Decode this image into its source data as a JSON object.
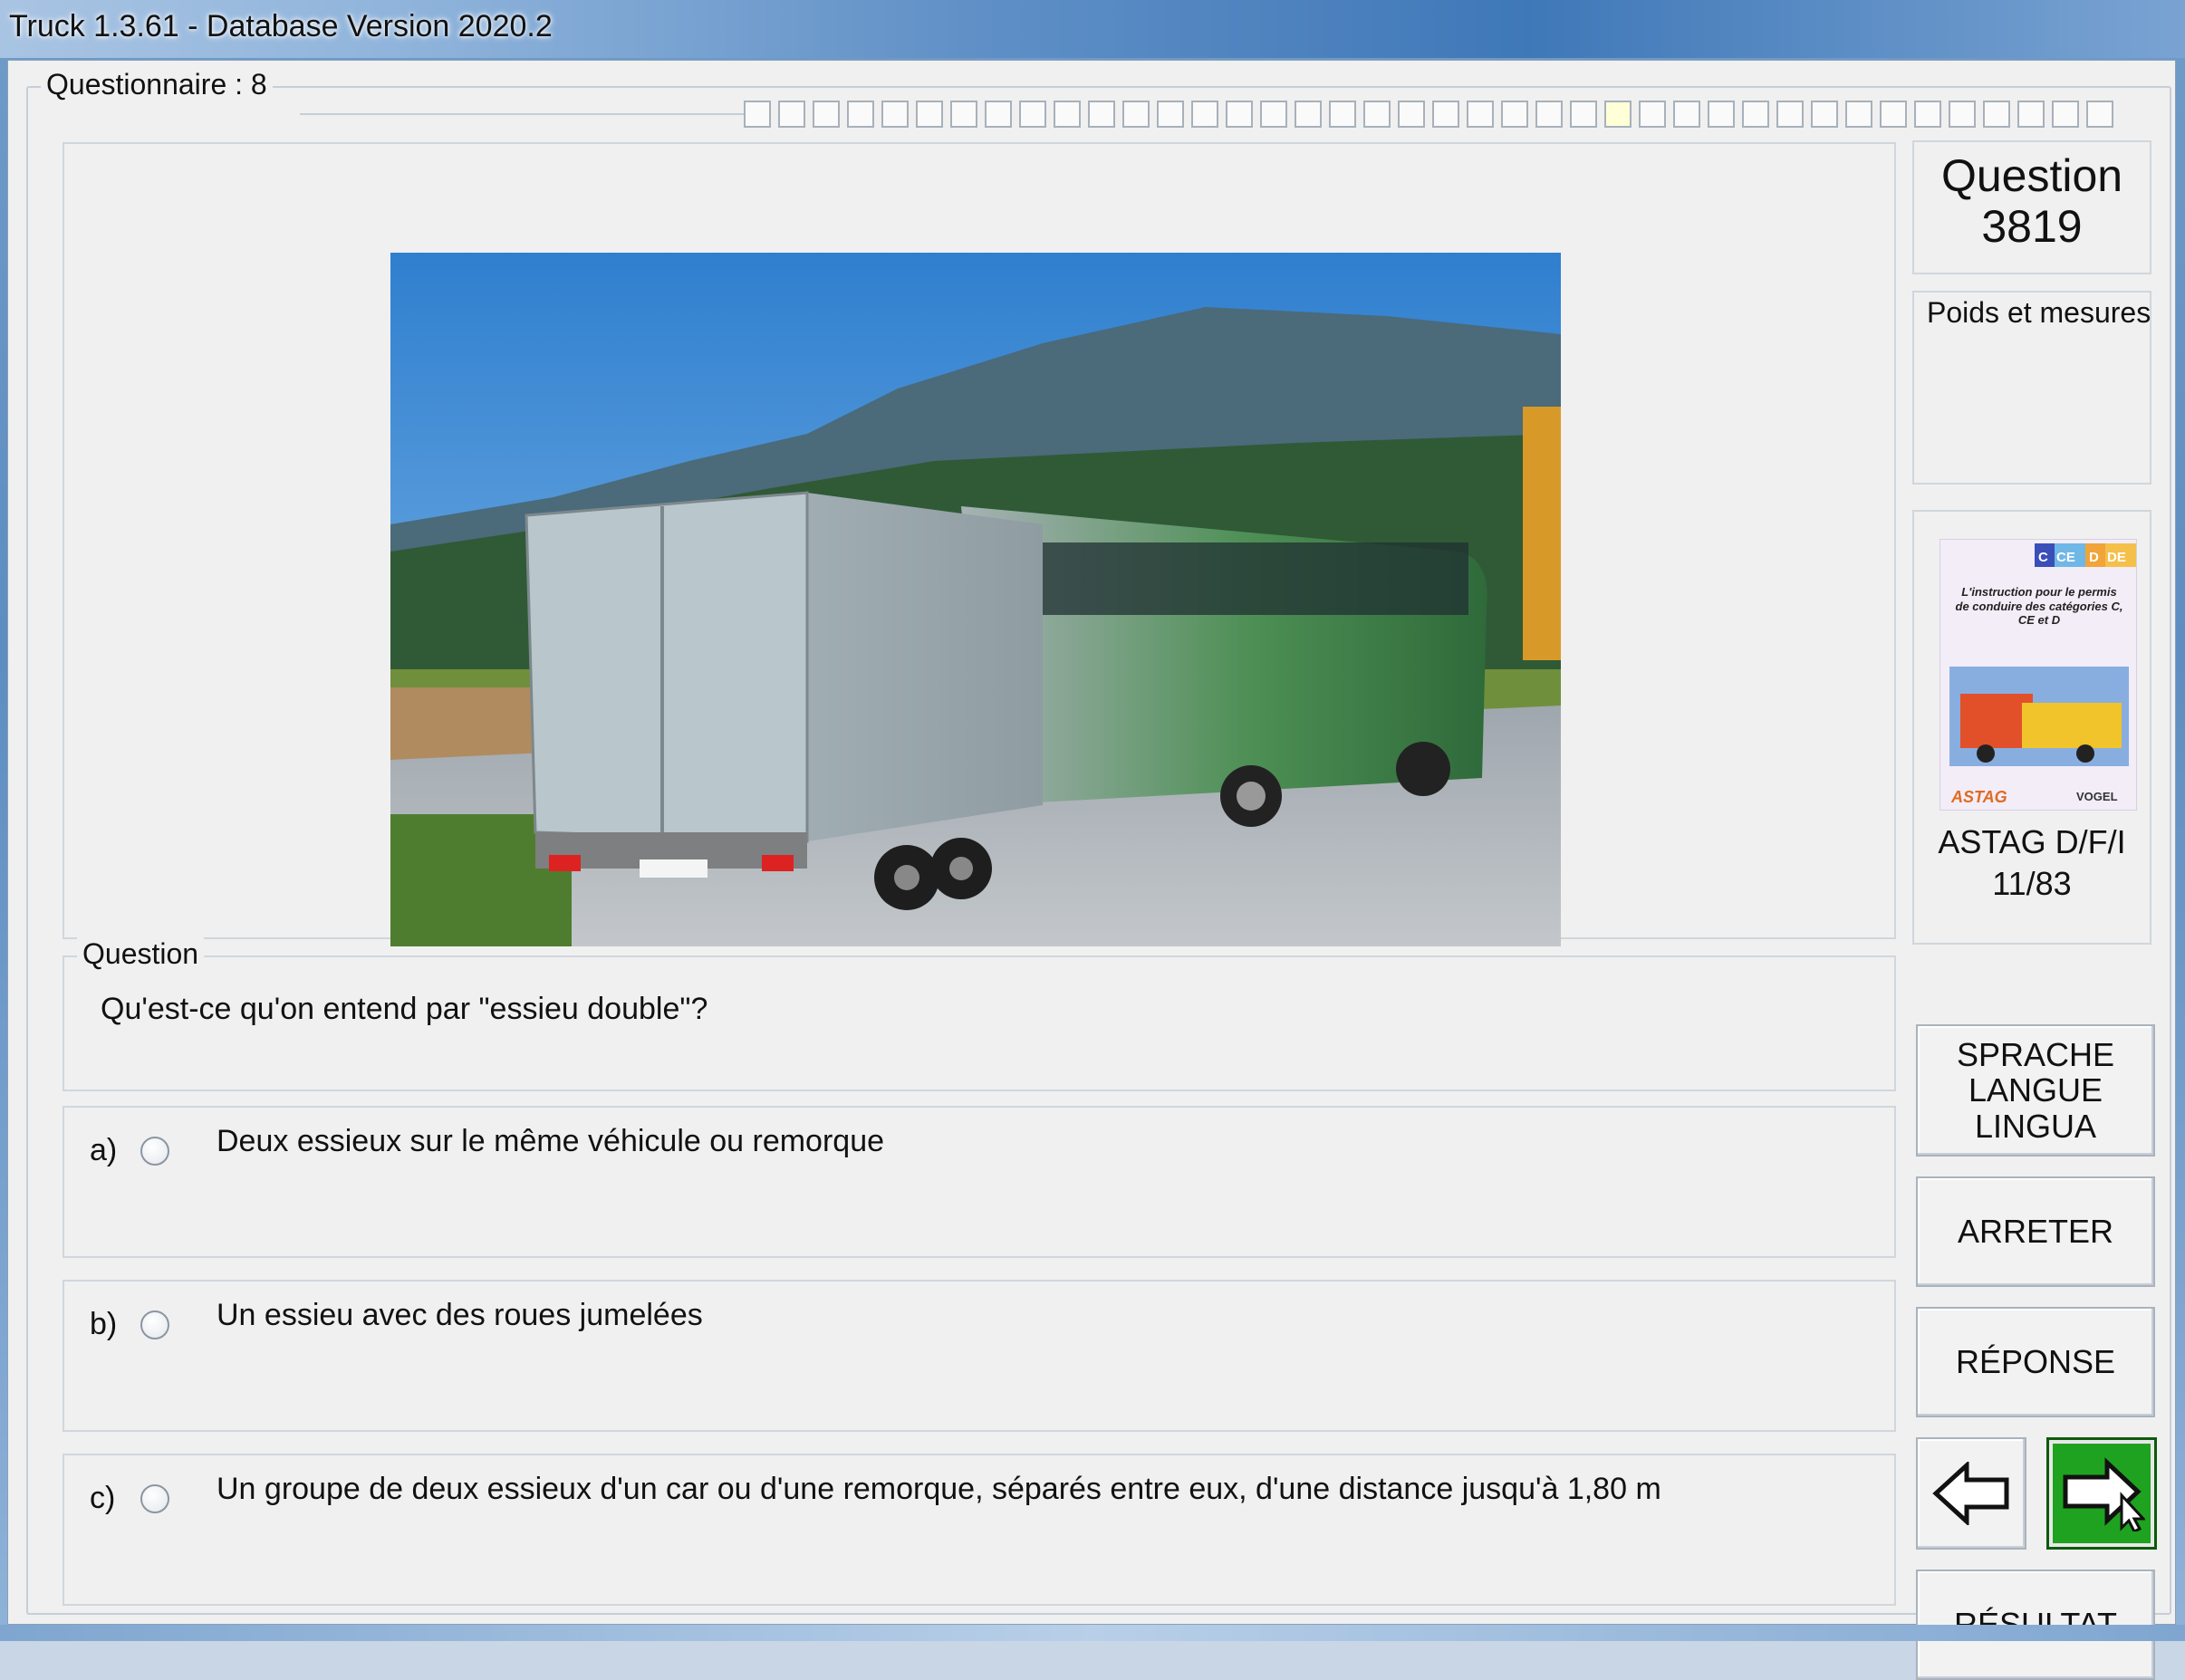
{
  "window": {
    "title": "Truck 1.3.61 - Database Version 2020.2"
  },
  "questionnaire": {
    "label": "Questionnaire : 8",
    "progress_total": 40,
    "progress_current_index": 25
  },
  "question_group_label": "Question",
  "question_text": "Qu'est-ce qu'on entend par \"essieu double\"?",
  "answers": [
    {
      "letter": "a)",
      "text": "Deux essieux sur le même véhicule ou remorque"
    },
    {
      "letter": "b)",
      "text": "Un essieu avec des roues jumelées"
    },
    {
      "letter": "c)",
      "text": "Un groupe de deux essieux d'un car ou d'une remorque, séparés entre eux, d'une distance jusqu'à 1,80 m"
    }
  ],
  "side": {
    "question_label": "Question",
    "question_number": "3819",
    "category": "Poids et mesures",
    "book": {
      "badges": [
        "C",
        "CE",
        "D",
        "DE"
      ],
      "cover_text": "L'instruction pour le permis de conduire des catégories C, CE et D",
      "publisher_left": "ASTAG",
      "publisher_right": "VOGEL",
      "label": "ASTAG D/F/I",
      "page": "11/83"
    }
  },
  "buttons": {
    "language": [
      "SPRACHE",
      "LANGUE",
      "LINGUA"
    ],
    "stop": "ARRETER",
    "answer": "RÉPONSE",
    "result": "RÉSULTAT"
  },
  "icons": {
    "prev": "left-arrow-icon",
    "next": "right-arrow-icon"
  },
  "colors": {
    "next_button": "#1fa21f",
    "title_gradient_dark": "#3f78b8"
  }
}
